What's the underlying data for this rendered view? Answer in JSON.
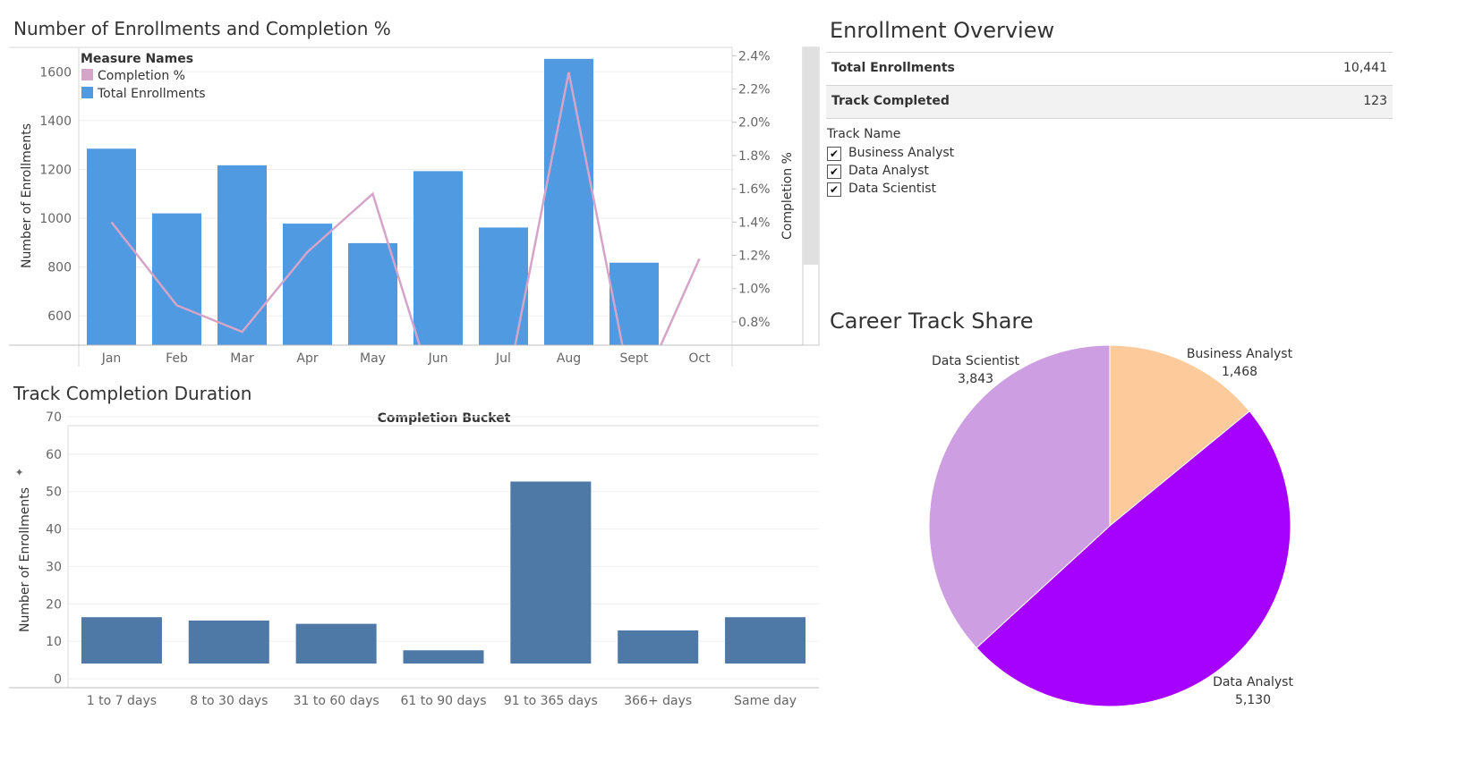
{
  "chart1": {
    "title": "Number of Enrollments and Completion %",
    "legend_title": "Measure Names",
    "legend_items": [
      {
        "label": "Completion %",
        "color": "#d4a5c9"
      },
      {
        "label": "Total Enrollments",
        "color": "#4f9ae0"
      }
    ]
  },
  "chart2": {
    "title": "Track Completion Duration",
    "header": "Completion Bucket"
  },
  "overview": {
    "title": "Enrollment Overview",
    "rows": [
      {
        "label": "Total Enrollments",
        "value": "10,441"
      },
      {
        "label": "Track Completed",
        "value": "123"
      }
    ],
    "filter_title": "Track Name",
    "filter_items": [
      {
        "label": "Business Analyst",
        "checked": "✔"
      },
      {
        "label": "Data Analyst",
        "checked": "✔"
      },
      {
        "label": "Data Scientist",
        "checked": "✔"
      }
    ]
  },
  "pie_title": "Career Track Share",
  "chart_data": [
    {
      "type": "bar",
      "combo": "bar + line (dual axis)",
      "categories": [
        "Jan",
        "Feb",
        "Mar",
        "Apr",
        "May",
        "Jun",
        "Jul",
        "Aug",
        "Sept",
        "Oct"
      ],
      "series": [
        {
          "name": "Total Enrollments",
          "axis": "left",
          "mark": "bar",
          "color": "#4f9ae0",
          "values": [
            1285,
            1020,
            1217,
            978,
            898,
            1193,
            962,
            1653,
            818,
            null
          ]
        },
        {
          "name": "Completion %",
          "axis": "right",
          "mark": "line",
          "color": "#d4a5c9",
          "values": [
            1.4,
            0.9,
            0.74,
            1.22,
            1.57,
            0.3,
            0.3,
            2.3,
            0.3,
            1.18
          ]
        }
      ],
      "ylabel": "Number of Enrollments",
      "ylim": [
        480,
        1700
      ],
      "yticks": [
        600,
        800,
        1000,
        1200,
        1400,
        1600
      ],
      "y2label": "Completion %",
      "y2lim": [
        0.66,
        2.45
      ],
      "y2ticks": [
        "0.8%",
        "1.0%",
        "1.2%",
        "1.4%",
        "1.6%",
        "1.8%",
        "2.0%",
        "2.2%",
        "2.4%"
      ],
      "y2tick_values": [
        0.8,
        1.0,
        1.2,
        1.4,
        1.6,
        1.8,
        2.0,
        2.2,
        2.4
      ],
      "grid": true,
      "legend_position": "top-left"
    },
    {
      "type": "bar",
      "title": "Completion Bucket",
      "categories": [
        "1 to 7 days",
        "8 to 30 days",
        "31 to 60 days",
        "61 to 90 days",
        "91 to 365 days",
        "366+ days",
        "Same day"
      ],
      "values": [
        14,
        13,
        12,
        4,
        55,
        10,
        14
      ],
      "color": "#4e79a7",
      "ylabel": "Number of Enrollments",
      "ylim": [
        0,
        70
      ],
      "yticks": [
        0,
        10,
        20,
        30,
        40,
        50,
        60,
        70
      ],
      "grid": true
    },
    {
      "type": "pie",
      "slices": [
        {
          "label": "Business Analyst",
          "value": 1468,
          "display": "1,468",
          "color": "#fdcb9b"
        },
        {
          "label": "Data Analyst",
          "value": 5130,
          "display": "5,130",
          "color": "#a600ff"
        },
        {
          "label": "Data Scientist",
          "value": 3843,
          "display": "3,843",
          "color": "#cd9ee2"
        }
      ]
    }
  ]
}
